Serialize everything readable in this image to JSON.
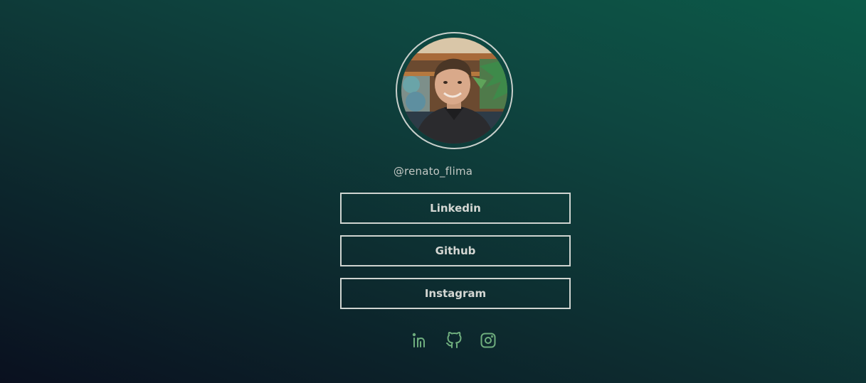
{
  "profile": {
    "username": "@renato_flima"
  },
  "links": [
    {
      "label": "Linkedin"
    },
    {
      "label": "Github"
    },
    {
      "label": "Instagram"
    }
  ],
  "socials": [
    {
      "icon": "linkedin-icon"
    },
    {
      "icon": "github-icon"
    },
    {
      "icon": "instagram-icon"
    }
  ],
  "colors": {
    "accent": "#6fae7e",
    "border": "#cfd4d0",
    "text": "#d4d7d3"
  }
}
